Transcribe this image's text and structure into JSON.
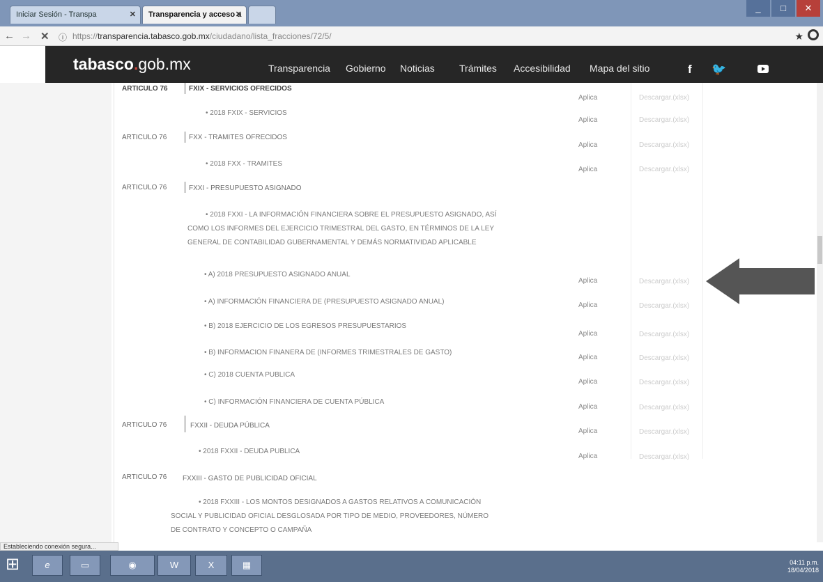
{
  "browser": {
    "tabs": [
      {
        "label": "Iniciar Sesión - Transpa"
      },
      {
        "label": "Transparencia y acceso a"
      }
    ],
    "url_prefix": "https://",
    "url_host": "transparencia.tabasco.gob.mx",
    "url_path": "/ciudadano/lista_fracciones/72/5/"
  },
  "site": {
    "logo_main": "tabasco",
    "logo_dot": ".",
    "logo_suffix": "gob.mx",
    "nav": [
      "Transparencia",
      "Gobierno",
      "Noticias",
      "Trámites",
      "Accesibilidad",
      "Mapa del sitio"
    ],
    "social_icons": [
      "facebook-icon",
      "twitter-icon",
      "youtube-icon"
    ]
  },
  "rows": [
    {
      "article": "ARTICULO 76",
      "fraction": "FXIX - SERVICIOS OFRECIDOS",
      "aplica": "Aplica",
      "desc": "Descargar.(xlsx)"
    },
    {
      "sub": "• 2018 FXIX - SERVICIOS",
      "aplica": "Aplica",
      "desc": "Descargar.(xlsx)"
    },
    {
      "article": "ARTICULO 76",
      "fraction": "FXX - TRAMITES OFRECIDOS",
      "aplica": "Aplica",
      "desc": "Descargar.(xlsx)"
    },
    {
      "sub": "• 2018 FXX - TRAMITES",
      "aplica": "Aplica",
      "desc": "Descargar.(xlsx)"
    },
    {
      "article": "ARTICULO 76",
      "fraction": "FXXI - PRESUPUESTO ASIGNADO"
    },
    {
      "sub_multiline": [
        "• 2018 FXXI - LA INFORMACIÓN FINANCIERA SOBRE EL PRESUPUESTO ASIGNADO, ASÍ",
        "COMO LOS INFORMES DEL EJERCICIO TRIMESTRAL DEL GASTO, EN TÉRMINOS DE LA LEY",
        "GENERAL DE CONTABILIDAD GUBERNAMENTAL Y DEMÁS NORMATIVIDAD APLICABLE"
      ]
    },
    {
      "sub": "• A) 2018 PRESUPUESTO ASIGNADO ANUAL",
      "aplica": "Aplica",
      "desc": "Descargar.(xlsx)"
    },
    {
      "sub": "• A) INFORMACIÓN FINANCIERA DE (PRESUPUESTO ASIGNADO ANUAL)",
      "aplica": "Aplica",
      "desc": "Descargar.(xlsx)"
    },
    {
      "sub": "• B) 2018 EJERCICIO DE LOS EGRESOS PRESUPUESTARIOS",
      "aplica": "Aplica",
      "desc": "Descargar.(xlsx)"
    },
    {
      "sub": "• B) INFORMACION FINANERA DE (INFORMES TRIMESTRALES DE GASTO)",
      "aplica": "Aplica",
      "desc": "Descargar.(xlsx)"
    },
    {
      "sub": "• C) 2018 CUENTA PUBLICA",
      "aplica": "Aplica",
      "desc": "Descargar.(xlsx)"
    },
    {
      "sub": "• C) INFORMACIÓN FINANCIERA DE CUENTA PÚBLICA",
      "aplica": "Aplica",
      "desc": "Descargar.(xlsx)"
    },
    {
      "article": "ARTICULO 76",
      "fraction": "FXXII - DEUDA PÚBLICA",
      "aplica": "Aplica",
      "desc": "Descargar.(xlsx)"
    },
    {
      "sub": "• 2018 FXXII - DEUDA PUBLICA",
      "aplica": "Aplica",
      "desc": "Descargar.(xlsx)"
    },
    {
      "article": "ARTICULO 76",
      "fraction": "FXXIII - GASTO DE PUBLICIDAD OFICIAL"
    },
    {
      "sub_multiline": [
        "• 2018 FXXIII - LOS MONTOS DESIGNADOS A GASTOS RELATIVOS A COMUNICACIÓN",
        "SOCIAL Y PUBLICIDAD OFICIAL DESGLOSADA POR TIPO DE MEDIO, PROVEEDORES, NÚMERO",
        "DE CONTRATO Y CONCEPTO O CAMPAÑA"
      ]
    }
  ],
  "status_bar": "Estableciendo conexión segura...",
  "taskbar": {
    "apps": [
      "ie-icon",
      "explorer-icon",
      "chrome-icon",
      "word-icon",
      "excel-icon",
      "app-icon"
    ],
    "time": "04:11 p.m.",
    "date": "18/04/2018"
  },
  "colors": {
    "header_bg": "#262626",
    "logo_dot": "#c9463d",
    "arrow": "#555555",
    "taskbar": "#5a6f8c"
  }
}
